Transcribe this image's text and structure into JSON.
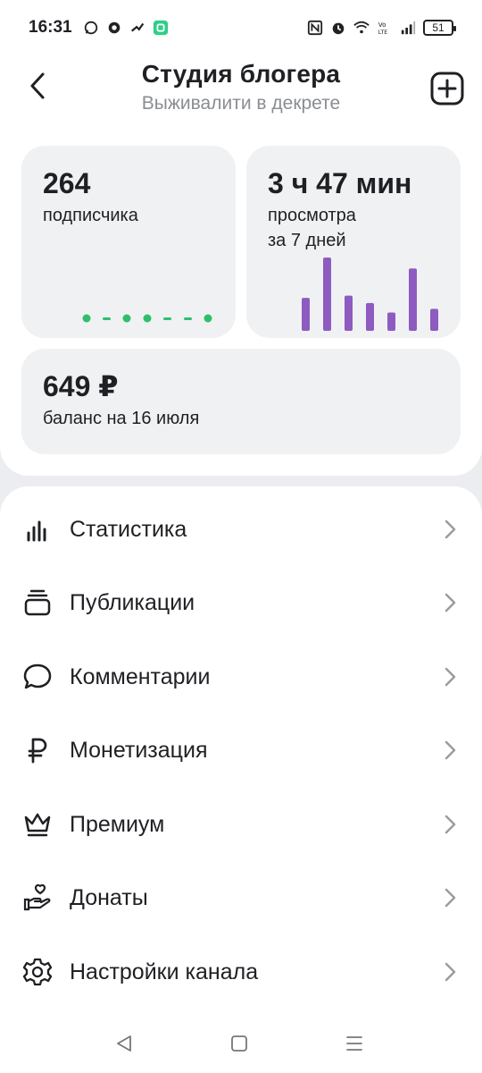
{
  "status_bar": {
    "time": "16:31",
    "left_icons": [
      "whatsapp-icon",
      "app-icon",
      "running-icon",
      "app-green-icon"
    ],
    "right_icons": [
      "nfc-icon",
      "alarm-icon",
      "wifi-icon",
      "volte-icon",
      "signal-icon"
    ],
    "battery": "51"
  },
  "header": {
    "title": "Студия блогера",
    "subtitle": "Выживалити в декрете"
  },
  "cards": {
    "subscribers": {
      "value": "264",
      "label": "подписчика",
      "trend_color": "#2fbf6c"
    },
    "views": {
      "value": "3 ч 47 мин",
      "label": "просмотра",
      "label2": "за 7 дней",
      "bar_color": "#8e5bc0",
      "bar_values": [
        0.45,
        1.0,
        0.48,
        0.38,
        0.25,
        0.85,
        0.3
      ]
    },
    "balance": {
      "value": "649 ₽",
      "label": "баланс на 16 июля"
    }
  },
  "menu": [
    {
      "label": "Статистика",
      "icon": "stats-icon"
    },
    {
      "label": "Публикации",
      "icon": "publications-icon"
    },
    {
      "label": "Комментарии",
      "icon": "comment-icon"
    },
    {
      "label": "Монетизация",
      "icon": "ruble-icon"
    },
    {
      "label": "Премиум",
      "icon": "crown-icon"
    },
    {
      "label": "Донаты",
      "icon": "donate-icon"
    },
    {
      "label": "Настройки канала",
      "icon": "gear-icon"
    }
  ],
  "nav": [
    "back-nav-icon",
    "home-nav-icon",
    "menu-nav-icon"
  ]
}
